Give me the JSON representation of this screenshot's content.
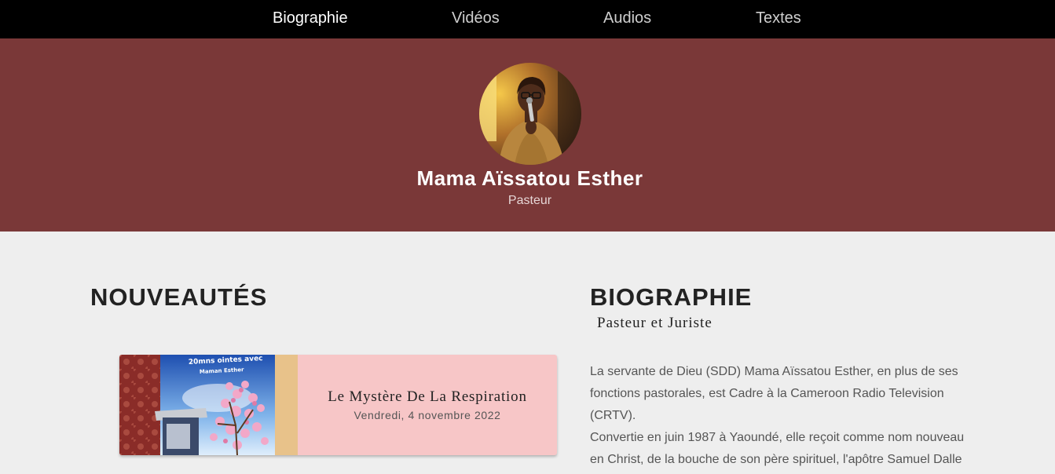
{
  "nav": {
    "items": [
      {
        "label": "Biographie",
        "active": true
      },
      {
        "label": "Vidéos"
      },
      {
        "label": "Audios"
      },
      {
        "label": "Textes"
      }
    ]
  },
  "hero": {
    "name": "Mama Aïssatou Esther",
    "role": "Pasteur"
  },
  "news": {
    "heading": "NOUVEAUTÉS",
    "items": [
      {
        "title": "Le Mystère De La Respiration",
        "date": "Vendredi, 4 novembre 2022",
        "thumb_banner_line1": "20mns ointes avec",
        "thumb_banner_line2": "Maman Esther"
      }
    ]
  },
  "bio": {
    "heading": "BIOGRAPHIE",
    "subtitle": "Pasteur et Juriste",
    "paragraphs": [
      "La servante de Dieu (SDD) Mama Aïssatou Esther, en plus de ses fonctions pastorales, est Cadre à la Cameroon Radio Television (CRTV).",
      "Convertie en juin 1987 à Yaoundé, elle reçoit comme nom nouveau en Christ, de la bouche de son père spirituel, l'apôtre Samuel Dalle"
    ]
  },
  "colors": {
    "nav_bg": "#000000",
    "hero_bg": "#7a3838",
    "page_bg": "#eeeeee",
    "card_bg": "#f7c6c7"
  }
}
